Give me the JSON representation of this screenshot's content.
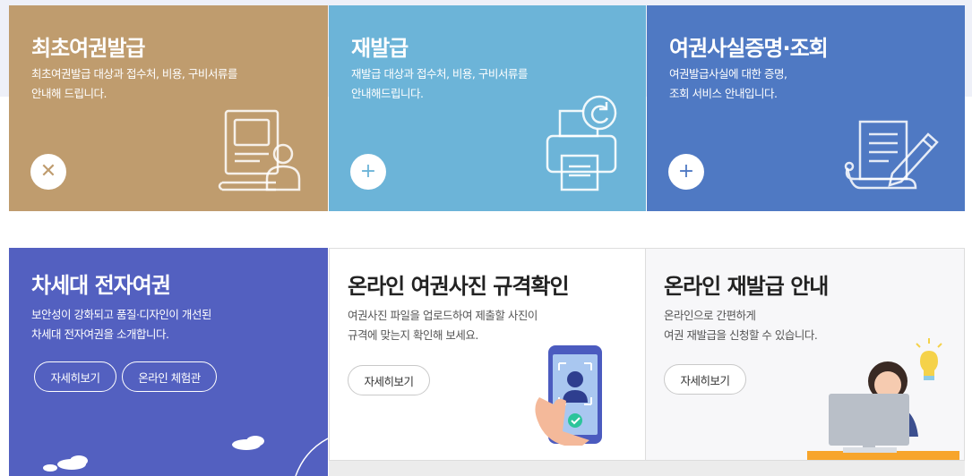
{
  "cards": [
    {
      "title": "최초여권발급",
      "desc": "최초여권발급 대상과 접수처, 비용, 구비서류를\n안내해 드립니다.",
      "action_icon": "plus-icon",
      "action_symbol": "✕",
      "illustration": "passport-person-icon",
      "color": "#bf9c6e"
    },
    {
      "title": "재발급",
      "desc": "재발급 대상과 접수처, 비용, 구비서류를\n안내해드립니다.",
      "action_icon": "plus-icon",
      "action_symbol": "+",
      "illustration": "printer-refresh-icon",
      "color": "#6cb4d8"
    },
    {
      "title": "여권사실증명·조회",
      "desc": "여권발급사실에 대한 증명,\n조회 서비스 안내입니다.",
      "action_icon": "plus-icon",
      "action_symbol": "+",
      "illustration": "document-pen-icon",
      "color": "#4f79c3"
    },
    {
      "title": "차세대 전자여권",
      "desc": "보안성이 강화되고 품질·디자인이 개선된\n차세대 전자여권을 소개합니다.",
      "buttons": [
        "자세히보기",
        "온라인 체험관"
      ],
      "illustration": "clouds-icon",
      "color": "#5360c0"
    },
    {
      "title": "온라인 여권사진 규격확인",
      "desc": "여권사진 파일을 업로드하여 제출할 사진이\n규격에 맞는지 확인해 보세요.",
      "buttons": [
        "자세히보기"
      ],
      "illustration": "phone-photo-check-icon"
    },
    {
      "title": "온라인 재발급 안내",
      "desc": "온라인으로 간편하게\n여권 재발급을 신청할 수 있습니다.",
      "buttons": [
        "자세히보기"
      ],
      "illustration": "person-computer-icon"
    }
  ]
}
